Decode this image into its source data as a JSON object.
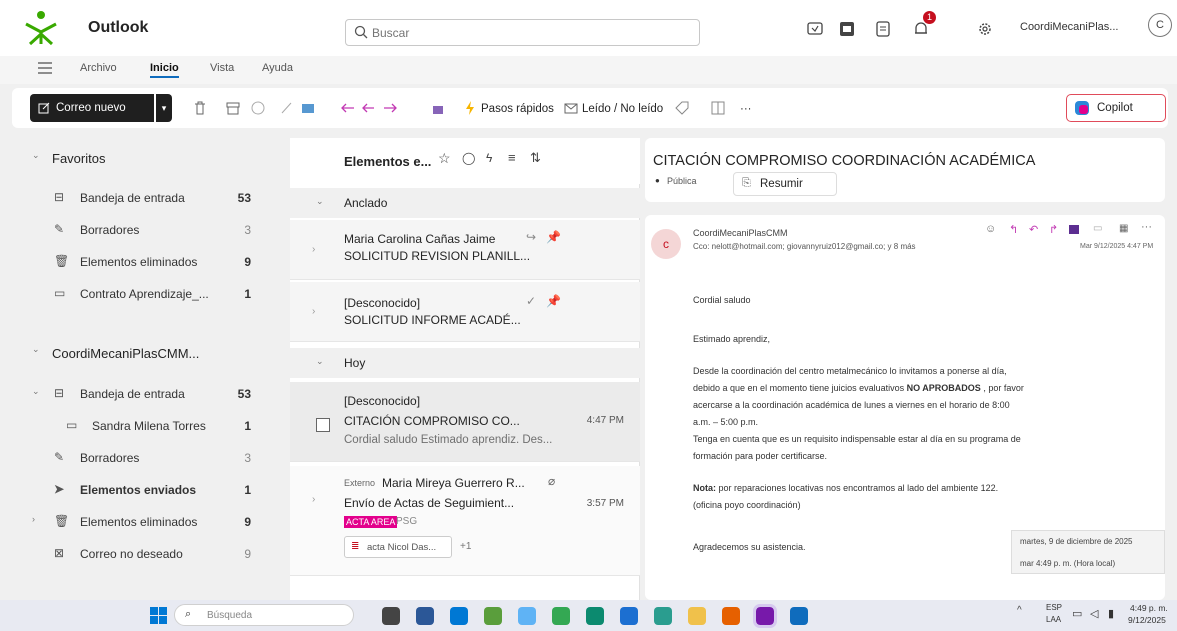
{
  "header": {
    "app_name": "Outlook",
    "search_placeholder": "Buscar",
    "account_name": "CoordiMecaniPlas...",
    "account_initial": "C",
    "notification_count": "1"
  },
  "menu": {
    "items": [
      "Archivo",
      "Inicio",
      "Vista",
      "Ayuda"
    ]
  },
  "ribbon": {
    "new_mail": "Correo nuevo",
    "quick_steps": "Pasos rápidos",
    "read_unread": "Leído / No leído",
    "more": "···",
    "copilot": "Copilot"
  },
  "folders": {
    "favorites_title": "Favoritos",
    "favorites": [
      {
        "label": "Bandeja de entrada",
        "count": "53",
        "icon": "inbox-icon",
        "bold_count": true
      },
      {
        "label": "Borradores",
        "count": "3",
        "icon": "drafts-icon",
        "bold_count": false
      },
      {
        "label": "Elementos eliminados",
        "count": "9",
        "icon": "trash-icon",
        "bold_count": true
      },
      {
        "label": "Contrato Aprendizaje_...",
        "count": "1",
        "icon": "folder-icon",
        "bold_count": true
      }
    ],
    "account_title": "CoordiMecaniPlasCMM...",
    "account": [
      {
        "label": "Bandeja de entrada",
        "count": "53",
        "icon": "inbox-icon",
        "bold_count": true
      },
      {
        "label": "Sandra Milena Torres",
        "count": "1",
        "icon": "folder-icon",
        "bold_count": true
      },
      {
        "label": "Borradores",
        "count": "3",
        "icon": "drafts-icon",
        "bold_count": false
      },
      {
        "label": "Elementos enviados",
        "count": "1",
        "icon": "send-icon",
        "bold_count": true
      },
      {
        "label": "Elementos eliminados",
        "count": "9",
        "icon": "trash-icon",
        "bold_count": true
      },
      {
        "label": "Correo no deseado",
        "count": "9",
        "icon": "junk-icon",
        "bold_count": false
      }
    ]
  },
  "message_list": {
    "title": "Elementos e...",
    "group_pinned": "Anclado",
    "group_today": "Hoy",
    "messages": [
      {
        "sender": "Maria Carolina Cañas Jaime",
        "subject": "SOLICITUD REVISION PLANILL...",
        "time": "",
        "preview": ""
      },
      {
        "sender": "[Desconocido]",
        "subject": "SOLICITUD INFORME ACADÉ...",
        "time": "",
        "preview": ""
      },
      {
        "sender": "[Desconocido]",
        "subject": "CITACIÓN COMPROMISO CO...",
        "time": "4:47 PM",
        "preview": "Cordial saludo Estimado aprendiz. Des..."
      },
      {
        "sender": "Maria Mireya Guerrero R...",
        "subject": "Envío de Actas de Seguimient...",
        "time": "3:57 PM",
        "preview": "",
        "tag_external": "Externo",
        "tag_category": "ACTA AREA",
        "tag_extra": "PSG",
        "attachment": "acta Nicol Das...",
        "attachment_more": "+1"
      }
    ]
  },
  "reading": {
    "subject": "CITACIÓN  COMPROMISO COORDINACIÓN ACADÉMICA",
    "visibility": "Pública",
    "summarize": "Resumir",
    "from": "CoordiMecaniPlasCMM",
    "avatar_initial": "c",
    "cc": "Cco: nelott@hotmail.com; giovannyruiz012@gmail.co; y 8 más",
    "date": "Mar 9/12/2025 4:47 PM",
    "body": [
      "Cordial saludo",
      "Estimado aprendiz,",
      "Desde la coordinación del centro metalmecánico lo invitamos a ponerse al día,",
      "debido a que en el momento tiene juicios evaluativos NO APROBADOS , por favor",
      "acercarse a la coordinación académica de lunes a viernes en el horario de 8:00",
      "a.m. – 5:00 p.m.",
      "Tenga en cuenta que es un requisito indispensable estar al día en su programa de",
      "formación para poder certificarse.",
      "Nota: por reparaciones locativas nos encontramos al lado del ambiente 122.",
      "(oficina poyo coordinación)",
      "Agradecemos su asistencia."
    ],
    "tooltip_date": "martes, 9 de diciembre de 2025",
    "tooltip_time": "mar 4:49 p. m. (Hora local)"
  },
  "taskbar": {
    "search": "Búsqueda",
    "lang": "ESP",
    "lang2": "LAA",
    "clock_time": "4:49 p. m.",
    "clock_date": "9/12/2025"
  },
  "colors": {
    "accent": "#0f6cbd",
    "dark_button": "#1f1f1f",
    "category_tag": "#e3008c",
    "pin": "#0f6cbd"
  }
}
